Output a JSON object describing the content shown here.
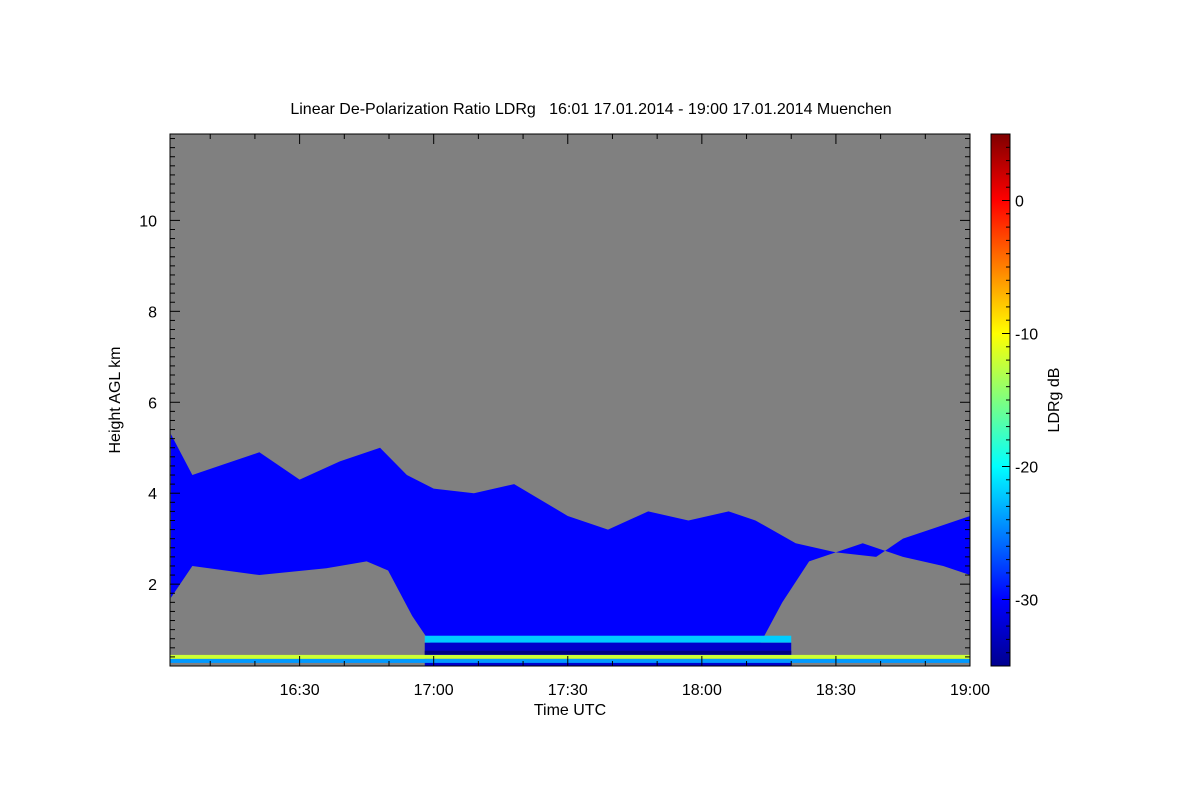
{
  "chart_data": {
    "type": "heatmap",
    "title": "Linear De-Polarization Ratio LDRg   16:01 17.01.2014 - 19:00 17.01.2014 Muenchen",
    "xlabel": "Time UTC",
    "ylabel": "Height AGL km",
    "colorbar_label": "LDRg dB",
    "xlim": [
      "16:01",
      "19:00"
    ],
    "ylim": [
      0.2,
      11.9
    ],
    "x_ticks": [
      "16:30",
      "17:00",
      "17:30",
      "18:00",
      "18:30",
      "19:00"
    ],
    "y_ticks": [
      2,
      4,
      6,
      8,
      10
    ],
    "colorbar_range": [
      -35,
      5
    ],
    "colorbar_ticks": [
      0,
      -10,
      -20,
      -30
    ],
    "colormap": "jet",
    "no_data_color": "#808080",
    "layers": [
      {
        "kind": "cloud",
        "approx_ldr_db": -30,
        "top_km": [
          [
            16.02,
            5.3
          ],
          [
            16.1,
            4.4
          ],
          [
            16.2,
            4.6
          ],
          [
            16.35,
            4.9
          ],
          [
            16.5,
            4.3
          ],
          [
            16.65,
            4.7
          ],
          [
            16.8,
            5.0
          ],
          [
            16.9,
            4.4
          ],
          [
            17.0,
            4.1
          ],
          [
            17.15,
            4.0
          ],
          [
            17.3,
            4.2
          ],
          [
            17.5,
            3.5
          ],
          [
            17.65,
            3.2
          ],
          [
            17.8,
            3.6
          ],
          [
            17.95,
            3.4
          ],
          [
            18.1,
            3.6
          ],
          [
            18.2,
            3.4
          ],
          [
            18.35,
            2.9
          ],
          [
            18.5,
            2.7
          ],
          [
            18.65,
            2.6
          ],
          [
            18.75,
            3.0
          ],
          [
            18.85,
            3.2
          ],
          [
            19.0,
            3.5
          ]
        ],
        "base_km": [
          [
            16.02,
            1.7
          ],
          [
            16.1,
            2.4
          ],
          [
            16.35,
            2.2
          ],
          [
            16.6,
            2.35
          ],
          [
            16.75,
            2.5
          ],
          [
            16.83,
            2.3
          ],
          [
            16.92,
            1.3
          ],
          [
            17.0,
            0.6
          ],
          [
            17.4,
            0.6
          ],
          [
            18.0,
            0.6
          ],
          [
            18.2,
            0.5
          ],
          [
            18.3,
            1.6
          ],
          [
            18.4,
            2.5
          ],
          [
            18.6,
            2.9
          ],
          [
            18.75,
            2.6
          ],
          [
            18.9,
            2.4
          ],
          [
            19.0,
            2.2
          ]
        ]
      },
      {
        "kind": "melting-layer",
        "approx_ldr_db": -22,
        "start": "16:58",
        "end": "18:20",
        "height_km": 0.8
      },
      {
        "kind": "near-ground-aerosol",
        "approx_ldr_db": -12,
        "start": "16:01",
        "end": "19:00",
        "height_km": 0.4
      }
    ]
  }
}
